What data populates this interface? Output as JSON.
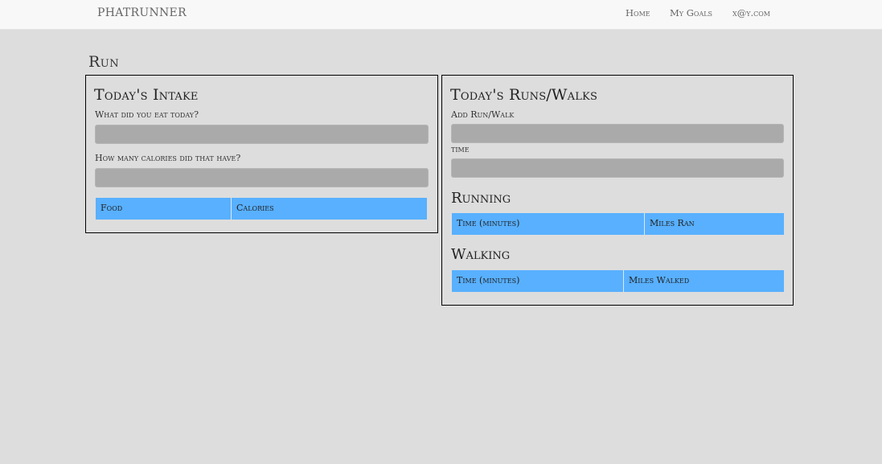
{
  "navbar": {
    "brand": "PHATRUNNER",
    "links": [
      "Home",
      "My Goals",
      "x@y.com"
    ]
  },
  "page": {
    "title": "Run"
  },
  "intake": {
    "heading": "Today's Intake",
    "food_label": "What did you eat today?",
    "food_value": "",
    "calories_label": "How many calories did that have?",
    "calories_value": "",
    "table_headers": [
      "Food",
      "Calories"
    ],
    "rows": []
  },
  "runs": {
    "heading": "Today's Runs/Walks",
    "add_label": "Add Run/Walk",
    "add_value": "",
    "time_label": "time",
    "time_value": "",
    "running": {
      "heading": "Running",
      "table_headers": [
        "Time (minutes)",
        "Miles Ran"
      ],
      "rows": []
    },
    "walking": {
      "heading": "Walking",
      "table_headers": [
        "Time (minutes)",
        "Miles Walked"
      ],
      "rows": []
    }
  },
  "colors": {
    "background": "#dddddd",
    "navbar": "#f8f8f8",
    "table_header": "#58b0ff",
    "input": "#aaaaaa",
    "panel_border": "#000000"
  }
}
